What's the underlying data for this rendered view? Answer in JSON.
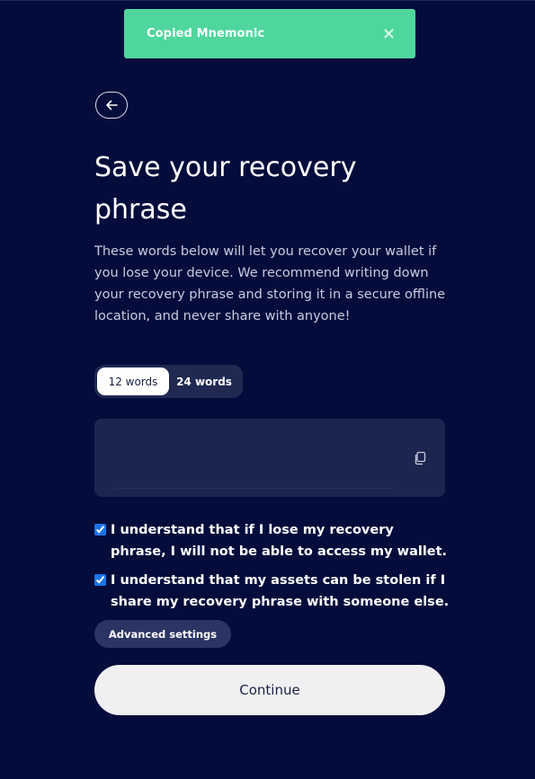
{
  "toast": {
    "message": "Copied Mnemonic",
    "close_icon": "close-icon",
    "close_glyph": "×",
    "color": "#4fd69c"
  },
  "back_button": {
    "icon": "arrow-left-icon"
  },
  "header": {
    "title_line1": "Save your recovery",
    "title_line2": "phrase",
    "description": "These words below will let you recover your wallet if you lose your device. We recommend writing down your recovery phrase and storing it in a secure offline location, and never share with anyone!"
  },
  "word_count_toggle": {
    "options": [
      {
        "label": "12 words",
        "selected": true
      },
      {
        "label": "24 words",
        "selected": false
      }
    ]
  },
  "phrase_box": {
    "copy_icon": "copy-icon"
  },
  "acknowledgements": [
    {
      "checked": true,
      "text": "I understand that if I lose my recovery phrase, I will not be able to access my wallet."
    },
    {
      "checked": true,
      "text": "I understand that my assets can be stolen if I share my recovery phrase with someone else."
    }
  ],
  "advanced_settings_label": "Advanced settings",
  "continue_label": "Continue",
  "colors": {
    "background": "#040c3b",
    "panel": "#1c2550",
    "toast": "#4fd69c",
    "button_light": "#f0f0f2"
  }
}
